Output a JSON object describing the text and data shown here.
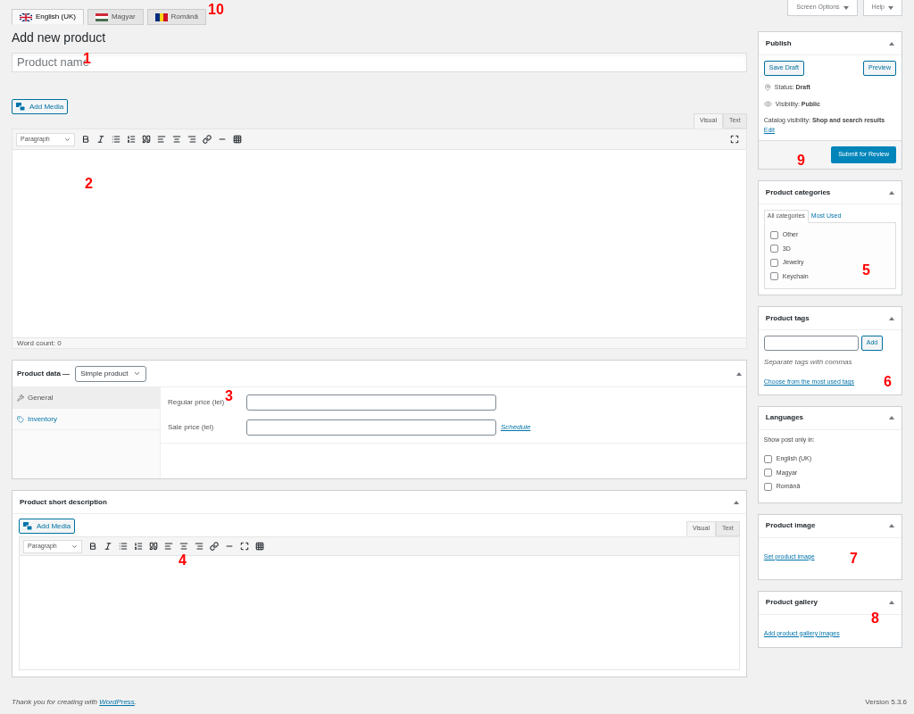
{
  "language_tabs": [
    {
      "label": "English (UK)",
      "kind": "uk",
      "selected": true
    },
    {
      "label": "Magyar",
      "kind": "hu",
      "selected": false
    },
    {
      "label": "Română",
      "kind": "ro",
      "selected": false
    }
  ],
  "screen_options": [
    "Screen Options",
    "Help"
  ],
  "title": "Add new product",
  "product_name": {
    "placeholder": "Product name"
  },
  "editor": {
    "add_media": "Add Media",
    "tabs": [
      {
        "label": "Visual",
        "selected": true
      },
      {
        "label": "Text",
        "selected": false
      }
    ],
    "format": "Paragraph",
    "word_count": "Word count: 0"
  },
  "product_data": {
    "label": "Product data —",
    "type": "Simple product",
    "tabs": [
      {
        "label": "General",
        "kind": "wrench",
        "selected": true
      },
      {
        "label": "Inventory",
        "kind": "tag",
        "selected": false
      }
    ],
    "fields": [
      {
        "label": "Regular price (lei)"
      },
      {
        "label": "Sale price (lei)",
        "link": "Schedule"
      }
    ]
  },
  "short_description": {
    "title": "Product short description",
    "add_media": "Add Media",
    "tabs": [
      {
        "label": "Visual",
        "selected": true
      },
      {
        "label": "Text",
        "selected": false
      }
    ],
    "format": "Paragraph"
  },
  "publish": {
    "title": "Publish",
    "save_draft": "Save Draft",
    "preview": "Preview",
    "status": "Status: **Draft**",
    "visibility": "Visibility: **Public**",
    "catalog": "Catalog visibility: **Shop and search results**",
    "edit": "Edit",
    "submit": "Submit for Review"
  },
  "categories": {
    "title": "Product categories",
    "tabs": [
      {
        "label": "All categories",
        "selected": true
      },
      {
        "label": "Most Used",
        "selected": false
      }
    ],
    "items": [
      {
        "label": "Other",
        "checked": false
      },
      {
        "label": "3D",
        "checked": false
      },
      {
        "label": "Jewelry",
        "checked": false
      },
      {
        "label": "Keychain",
        "checked": false
      }
    ]
  },
  "tags": {
    "title": "Product tags",
    "add": "Add",
    "hint": "Separate tags with commas",
    "link": "Choose from the most used tags"
  },
  "languages": {
    "title": "Languages",
    "label": "Show post only in:",
    "items": [
      {
        "label": "English (UK)",
        "checked": false
      },
      {
        "label": "Magyar",
        "checked": false
      },
      {
        "label": "Română",
        "checked": false
      }
    ]
  },
  "product_image": {
    "title": "Product image",
    "link": "Set product image"
  },
  "product_gallery": {
    "title": "Product gallery",
    "link": "Add product gallery images"
  },
  "callouts": [
    "1",
    "2",
    "3",
    "4",
    "5",
    "6",
    "7",
    "8",
    "9",
    "10"
  ],
  "footer": {
    "thanks": "Thank you for creating with",
    "link": "WordPress",
    "end": ".",
    "version": "Version 5.3.6"
  }
}
